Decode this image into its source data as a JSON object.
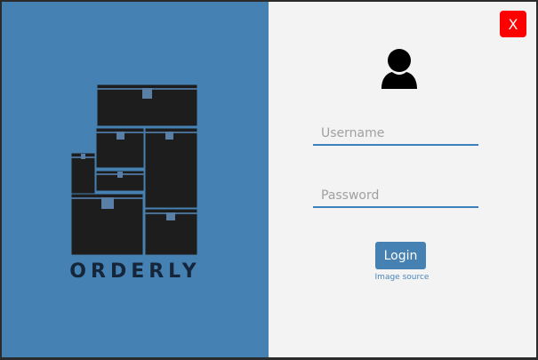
{
  "brand": {
    "name": "ORDERLY"
  },
  "close_button": {
    "label": "X"
  },
  "login_form": {
    "username_placeholder": "Username",
    "username_value": "",
    "password_placeholder": "Password",
    "password_value": "",
    "login_label": "Login",
    "image_source_link": "Image source"
  },
  "icons": {
    "logo": "stacked-boxes-icon",
    "user": "user-icon"
  },
  "colors": {
    "left_panel": "#4681b3",
    "right_panel": "#f3f3f3",
    "boxes": "#1d1d1d",
    "close": "#ff0000",
    "accent": "#3b7fbd",
    "brand_text": "#15253a"
  }
}
